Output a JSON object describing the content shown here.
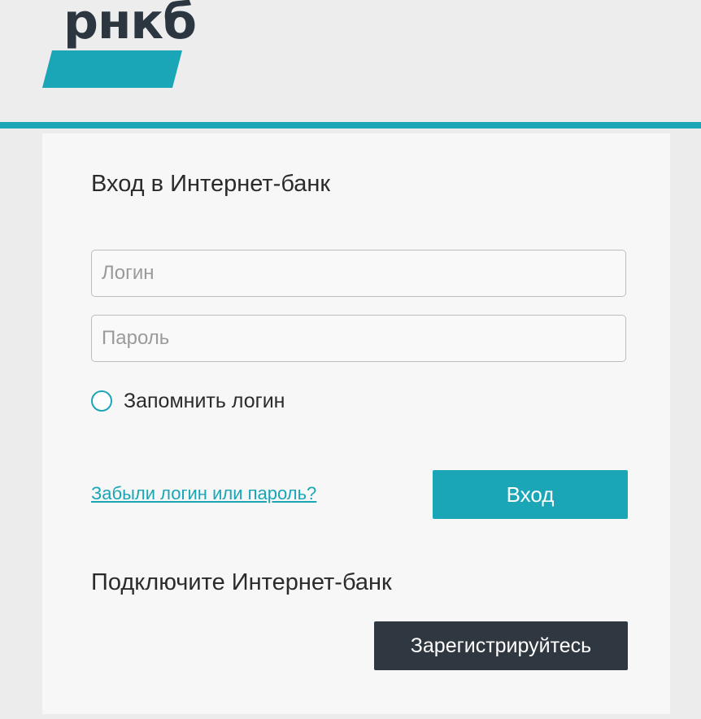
{
  "brand": {
    "logo_text": "рнкб",
    "accent_color": "#1aa6b7",
    "dark_color": "#2f3740"
  },
  "login_form": {
    "title": "Вход в Интернет-банк",
    "login_placeholder": "Логин",
    "password_placeholder": "Пароль",
    "remember_label": "Запомнить логин",
    "forgot_link": "Забыли логин или пароль?",
    "submit_label": "Вход"
  },
  "register": {
    "title": "Подключите Интернет-банк",
    "button_label": "Зарегистрируйтесь"
  }
}
